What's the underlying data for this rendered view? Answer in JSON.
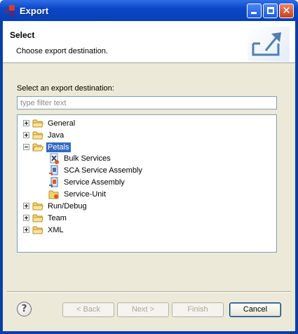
{
  "window": {
    "title": "Export"
  },
  "banner": {
    "title": "Select",
    "description": "Choose export destination."
  },
  "filter": {
    "label": "Select an export destination:",
    "placeholder": "type filter text"
  },
  "tree": {
    "items": [
      {
        "label": "General",
        "kind": "folder",
        "expanded": false
      },
      {
        "label": "Java",
        "kind": "folder",
        "expanded": false
      },
      {
        "label": "Petals",
        "kind": "folder",
        "expanded": true,
        "selected": true
      },
      {
        "label": "Bulk Services",
        "kind": "leaf",
        "icon": "bulk-services-icon"
      },
      {
        "label": "SCA Service Assembly",
        "kind": "leaf",
        "icon": "sca-service-assembly-icon"
      },
      {
        "label": "Service Assembly",
        "kind": "leaf",
        "icon": "service-assembly-icon"
      },
      {
        "label": "Service-Unit",
        "kind": "leaf",
        "icon": "service-unit-icon"
      },
      {
        "label": "Run/Debug",
        "kind": "folder",
        "expanded": false
      },
      {
        "label": "Team",
        "kind": "folder",
        "expanded": false
      },
      {
        "label": "XML",
        "kind": "folder",
        "expanded": false
      }
    ]
  },
  "buttons": {
    "help": "?",
    "back": "< Back",
    "next": "Next >",
    "finish": "Finish",
    "cancel": "Cancel"
  },
  "colors": {
    "selection": "#316ac5",
    "titlebar": "#0b47c9",
    "dialog_bg": "#ece9d8"
  }
}
